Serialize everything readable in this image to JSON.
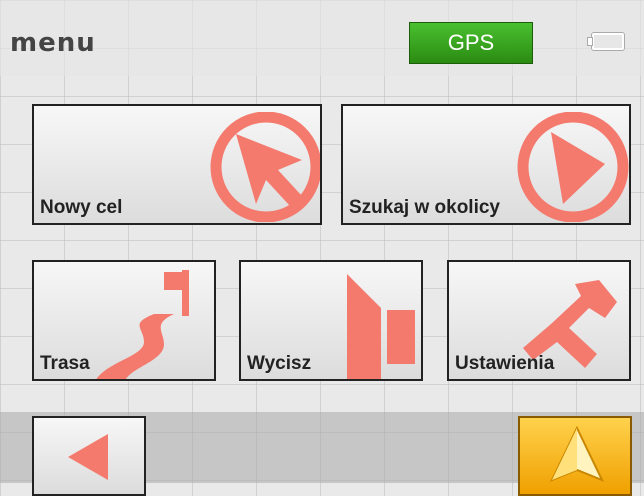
{
  "header": {
    "title": "menu",
    "gps_label": "GPS",
    "battery_icon": "battery-icon"
  },
  "tiles": [
    {
      "label": "Nowy cel",
      "icon": "cursor-arrow-icon"
    },
    {
      "label": "Szukaj w okolicy",
      "icon": "play-triangle-icon"
    },
    {
      "label": "Trasa",
      "icon": "route-flag-icon"
    },
    {
      "label": "Wycisz",
      "icon": "speaker-mute-icon"
    },
    {
      "label": "Ustawienia",
      "icon": "wrench-icon"
    }
  ],
  "footer": {
    "back_icon": "back-arrow-icon",
    "navigate_icon": "navigation-arrow-icon"
  },
  "colors": {
    "icon_red": "#f47a6e",
    "gps_green": "#3aa822",
    "nav_orange": "#f4a900"
  }
}
